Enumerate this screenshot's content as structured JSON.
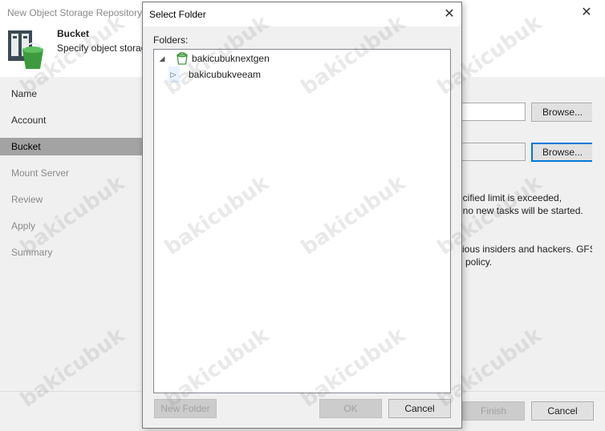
{
  "wizard": {
    "title": "New Object Storage Repository",
    "close": "✕",
    "header_title": "Bucket",
    "header_subtitle": "Specify object storag",
    "nav": [
      "Name",
      "Account",
      "Bucket",
      "Mount Server",
      "Review",
      "Apply",
      "Summary"
    ],
    "browse_1": "Browse...",
    "browse_2": "Browse...",
    "text_1": "ecified limit is exceeded,",
    "text_2": "t no new tasks will be started.",
    "text_3": "cious insiders and hackers. GFS",
    "text_4": "n policy.",
    "finish": "Finish",
    "cancel": "Cancel"
  },
  "dialog": {
    "title": "Select Folder",
    "close": "✕",
    "folders_label": "Folders:",
    "tree": [
      {
        "label": "bakicubuknextgen",
        "expander": "◢"
      },
      {
        "label": "bakicubukveeam",
        "expander": "▷"
      }
    ],
    "new_folder": "New Folder",
    "ok": "OK",
    "cancel": "Cancel"
  },
  "watermark": "bakicubuk"
}
